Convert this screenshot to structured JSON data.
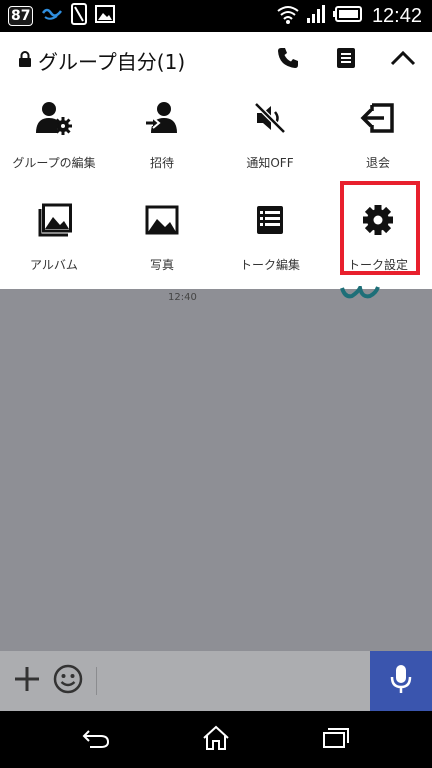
{
  "status_bar": {
    "badge": "87",
    "time": "12:42"
  },
  "header": {
    "title": "グループ自分(1)",
    "icons": [
      "lock-icon",
      "phone-icon",
      "note-icon",
      "chevron-up-icon"
    ]
  },
  "menu": {
    "items": [
      {
        "label": "グループの編集",
        "icon": "group-edit-icon"
      },
      {
        "label": "招待",
        "icon": "invite-icon"
      },
      {
        "label": "通知OFF",
        "icon": "mute-icon"
      },
      {
        "label": "退会",
        "icon": "leave-icon"
      },
      {
        "label": "アルバム",
        "icon": "album-icon"
      },
      {
        "label": "写真",
        "icon": "photo-icon"
      },
      {
        "label": "トーク編集",
        "icon": "list-icon"
      },
      {
        "label": "トーク設定",
        "icon": "gear-icon"
      }
    ],
    "highlight_color": "#e8202d"
  },
  "chat": {
    "time": "12:40"
  },
  "input_bar": {
    "mic_color": "#3a55ae"
  }
}
